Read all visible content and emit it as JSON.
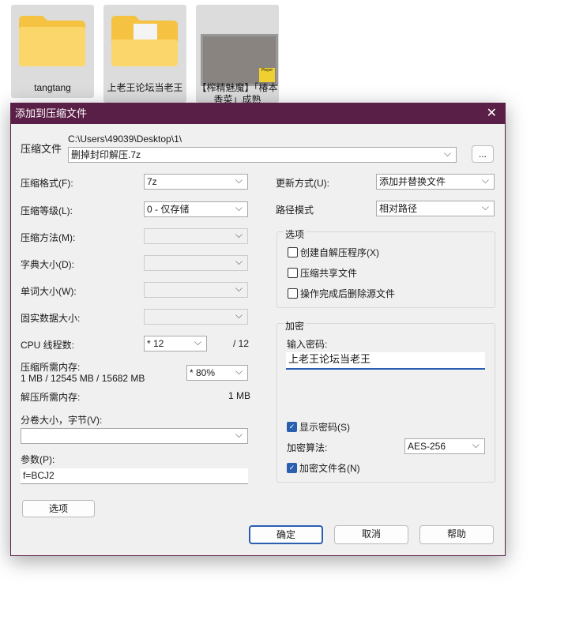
{
  "desktop": {
    "items": [
      {
        "name": "tangtang"
      },
      {
        "name": "上老王论坛当老王"
      },
      {
        "name": "【榨精魅魔】「椿本香菜」成熟"
      }
    ],
    "video_badge": "Player"
  },
  "dialog": {
    "title": "添加到压缩文件",
    "archive_label": "压缩文件",
    "archive_path": "C:\\Users\\49039\\Desktop\\1\\",
    "archive_name": "删掉封印解压.7z",
    "browse": "...",
    "format_label": "压缩格式(F):",
    "format": "7z",
    "level_label": "压缩等级(L):",
    "level": "0 - 仅存储",
    "method_label": "压缩方法(M):",
    "dict_label": "字典大小(D):",
    "word_label": "单词大小(W):",
    "solid_label": "固实数据大小:",
    "cpu_label": "CPU 线程数:",
    "cpu": "* 12",
    "cpu_max": "/ 12",
    "mem_label": "压缩所需内存:",
    "mem_values": "1 MB / 12545 MB / 15682 MB",
    "mem_pct": "* 80%",
    "decomp_label": "解压所需内存:",
    "decomp_value": "1 MB",
    "split_label": "分卷大小，字节(V):",
    "split": "",
    "params_label": "参数(P):",
    "params": "f=BCJ2",
    "options_btn": "选项",
    "update_label": "更新方式(U):",
    "update": "添加并替换文件",
    "path_label": "路径模式",
    "path": "相对路径",
    "opts_group": "选项",
    "opts": [
      {
        "label": "创建自解压程序(X)",
        "checked": false
      },
      {
        "label": "压缩共享文件",
        "checked": false
      },
      {
        "label": "操作完成后删除源文件",
        "checked": false
      }
    ],
    "enc_group": "加密",
    "pwd_label": "输入密码:",
    "pwd": "上老王论坛当老王",
    "show_pwd": "显示密码(S)",
    "enc_method_label": "加密算法:",
    "enc_method": "AES-256",
    "enc_names": "加密文件名(N)",
    "ok": "确定",
    "cancel": "取消",
    "help": "帮助"
  },
  "colors": {
    "titlebar": "#5a1f47",
    "accent": "#2a5fb0"
  }
}
